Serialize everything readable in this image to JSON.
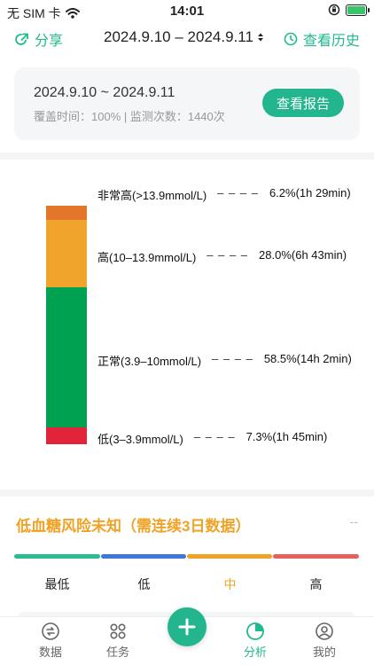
{
  "status_bar": {
    "carrier": "无 SIM 卡",
    "time": "14:01"
  },
  "header": {
    "share_label": "分享",
    "date_range": "2024.9.10 – 2024.9.11",
    "history_label": "查看历史"
  },
  "report": {
    "range": "2024.9.10 ~ 2024.9.11",
    "meta": "覆盖时间：100% | 监测次数：1440次",
    "button_label": "查看报告"
  },
  "distribution": {
    "ranges": [
      {
        "name": "非常高(>13.9mmol/L)",
        "summary": "6.2%(1h 29min)",
        "percent": 6.2,
        "color": "#e3762b"
      },
      {
        "name": "高(10–13.9mmol/L)",
        "summary": "28.0%(6h 43min)",
        "percent": 28.0,
        "color": "#f1a42c"
      },
      {
        "name": "正常(3.9–10mmol/L)",
        "summary": "58.5%(14h 2min)",
        "percent": 58.5,
        "color": "#00a251"
      },
      {
        "name": "低(3–3.9mmol/L)",
        "summary": "7.3%(1h 45min)",
        "percent": 7.3,
        "color": "#e2243a"
      }
    ],
    "dash": "– – – –"
  },
  "risk": {
    "title": "低血糖风险未知（需连续3日数据）",
    "value": "--",
    "levels": [
      {
        "label": "最低",
        "color": "#2bbd8f"
      },
      {
        "label": "低",
        "color": "#3f78d8"
      },
      {
        "label": "中",
        "color": "#f0a225"
      },
      {
        "label": "高",
        "color": "#e5615a"
      }
    ],
    "active_level": "中"
  },
  "tabs": [
    {
      "label": "数据",
      "icon": "data-icon"
    },
    {
      "label": "任务",
      "icon": "task-icon"
    },
    {
      "label": "分析",
      "icon": "analysis-icon"
    },
    {
      "label": "我的",
      "icon": "profile-icon"
    }
  ],
  "colors": {
    "accent": "#23b68e",
    "warning": "#f0a225"
  }
}
